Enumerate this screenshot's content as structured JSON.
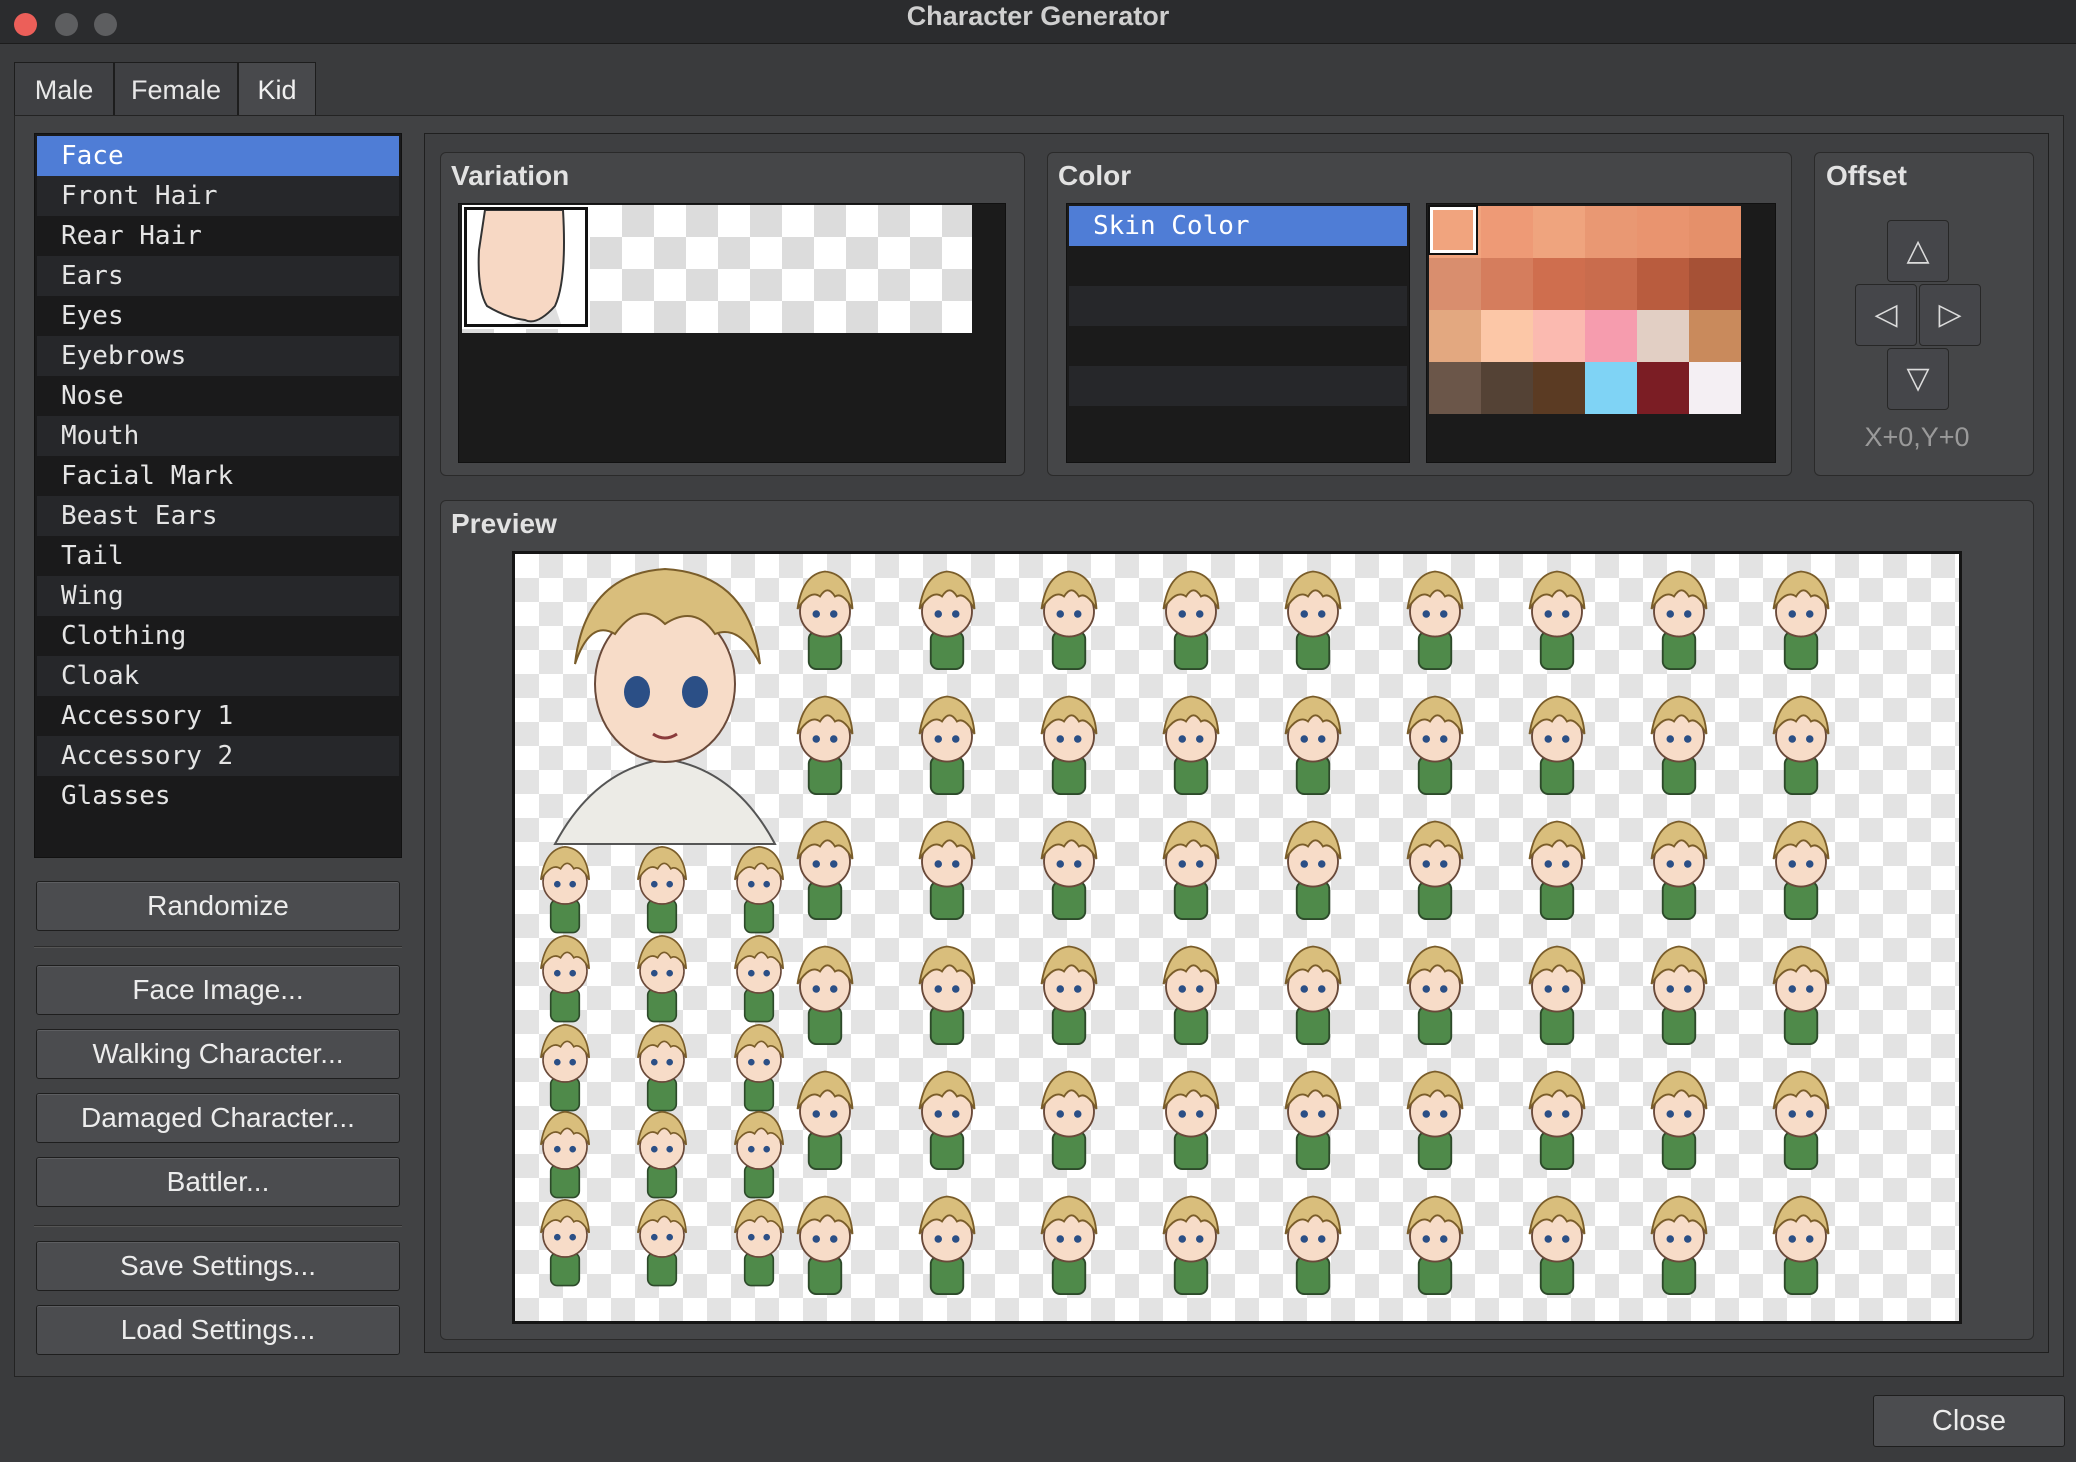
{
  "window": {
    "title": "Character Generator"
  },
  "tabs": [
    {
      "label": "Male"
    },
    {
      "label": "Female"
    },
    {
      "label": "Kid",
      "active": true
    }
  ],
  "parts": {
    "selected": "Face",
    "items": [
      "Face",
      "Front Hair",
      "Rear Hair",
      "Ears",
      "Eyes",
      "Eyebrows",
      "Nose",
      "Mouth",
      "Facial Mark",
      "Beast Ears",
      "Tail",
      "Wing",
      "Clothing",
      "Cloak",
      "Accessory 1",
      "Accessory 2",
      "Glasses"
    ]
  },
  "buttons": {
    "randomize": "Randomize",
    "face_image": "Face Image...",
    "walking_character": "Walking Character...",
    "damaged_character": "Damaged Character...",
    "battler": "Battler...",
    "save_settings": "Save Settings...",
    "load_settings": "Load Settings...",
    "close": "Close"
  },
  "variation": {
    "title": "Variation"
  },
  "color": {
    "title": "Color",
    "items": [
      "Skin Color"
    ],
    "palette": [
      [
        "#f1a47e",
        "#ee9a76",
        "#efa47e",
        "#e99873",
        "#e9946f",
        "#e5906a"
      ],
      [
        "#d98e6e",
        "#d57d5d",
        "#cf6e4e",
        "#c96c4d",
        "#b95c3e",
        "#a65136"
      ],
      [
        "#e3a880",
        "#fcc7a7",
        "#fbbab0",
        "#f69cae",
        "#e2cfc4",
        "#c98a5c"
      ],
      [
        "#6b5649",
        "#544235",
        "#5b3b23",
        "#7fd3f5",
        "#7b1d24",
        "#f4eff3"
      ]
    ]
  },
  "offset": {
    "title": "Offset",
    "readout": "X+0,Y+0"
  },
  "preview": {
    "title": "Preview"
  },
  "colors": {
    "selection": "#4f7dd6",
    "window_bg": "#3a3b3d",
    "hair": "#d9be7c",
    "clothing": "#4f8a4a"
  }
}
